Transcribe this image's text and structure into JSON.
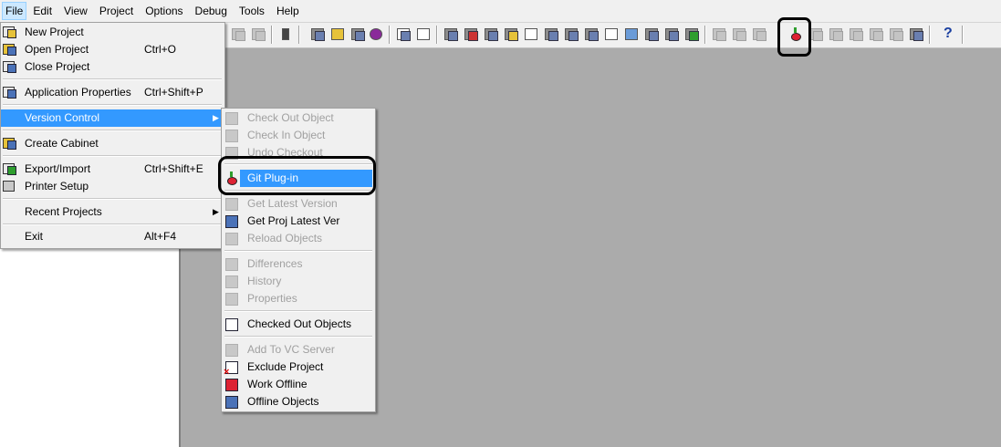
{
  "menubar": {
    "items": [
      {
        "label": "File",
        "active": true
      },
      {
        "label": "Edit"
      },
      {
        "label": "View"
      },
      {
        "label": "Project"
      },
      {
        "label": "Options"
      },
      {
        "label": "Debug"
      },
      {
        "label": "Tools"
      },
      {
        "label": "Help"
      }
    ]
  },
  "file_menu": {
    "items": [
      {
        "label": "New Project",
        "shortcut": "",
        "icon": "new-project-icon"
      },
      {
        "label": "Open Project",
        "shortcut": "Ctrl+O",
        "icon": "open-folder-icon"
      },
      {
        "label": "Close Project",
        "shortcut": "",
        "icon": "close-project-icon"
      },
      {
        "label": "Application Properties",
        "shortcut": "Ctrl+Shift+P",
        "icon": "properties-icon"
      },
      {
        "label": "Version Control",
        "shortcut": "",
        "icon": "",
        "submenu": true,
        "highlighted": true
      },
      {
        "label": "Create Cabinet",
        "shortcut": "",
        "icon": "cabinet-icon"
      },
      {
        "label": "Export/Import",
        "shortcut": "Ctrl+Shift+E",
        "icon": "export-import-icon"
      },
      {
        "label": "Printer Setup",
        "shortcut": "",
        "icon": "printer-icon"
      },
      {
        "label": "Recent Projects",
        "shortcut": "",
        "icon": "",
        "submenu": true
      },
      {
        "label": "Exit",
        "shortcut": "Alt+F4",
        "icon": ""
      }
    ]
  },
  "vc_menu": {
    "items": [
      {
        "label": "Check Out Object",
        "enabled": false
      },
      {
        "label": "Check In Object",
        "enabled": false
      },
      {
        "label": "Undo Checkout",
        "enabled": false
      },
      {
        "label": "Git Plug-in",
        "enabled": true,
        "highlighted": true
      },
      {
        "label": "Get Latest Version",
        "enabled": false
      },
      {
        "label": "Get Proj Latest Ver",
        "enabled": true
      },
      {
        "label": "Reload Objects",
        "enabled": false
      },
      {
        "label": "Differences",
        "enabled": false
      },
      {
        "label": "History",
        "enabled": false
      },
      {
        "label": "Properties",
        "enabled": false
      },
      {
        "label": "Checked Out Objects",
        "enabled": true
      },
      {
        "label": "Add To VC Server",
        "enabled": false
      },
      {
        "label": "Exclude Project",
        "enabled": true
      },
      {
        "label": "Work Offline",
        "enabled": true
      },
      {
        "label": "Offline Objects",
        "enabled": true
      }
    ]
  },
  "toolbar": {
    "help_label": "?"
  },
  "colors": {
    "highlight": "#3399ff",
    "workspace": "#ababab",
    "menu_bg": "#f0f0f0"
  }
}
